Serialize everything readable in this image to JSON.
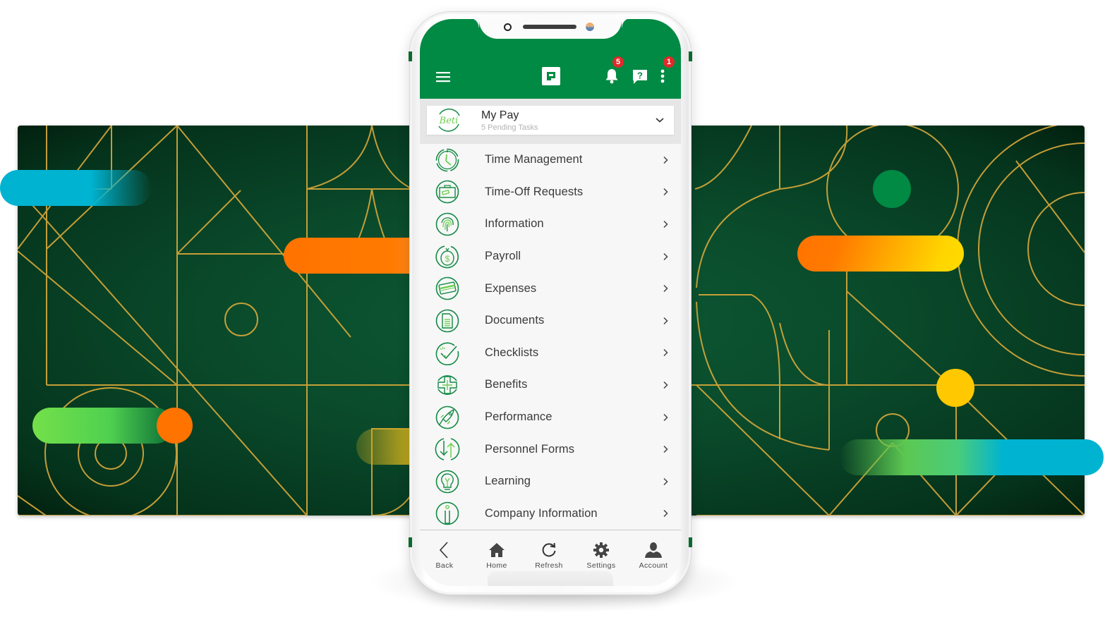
{
  "app": {
    "name": "Paycom",
    "brand_color": "#008a43",
    "badge_color": "#e02a2a"
  },
  "header": {
    "menu_icon": "hamburger-icon",
    "logo_icon": "paycom-logo-icon",
    "notifications": {
      "icon": "bell-icon",
      "count": "5"
    },
    "help": {
      "icon": "help-chat-icon",
      "glyph": "?"
    },
    "more": {
      "icon": "kebab-menu-icon",
      "count": "1"
    }
  },
  "context": {
    "logo": "Beti",
    "title": "My Pay",
    "subtitle": "5 Pending Tasks",
    "chevron": "chevron-down-icon"
  },
  "menu": {
    "items": [
      {
        "label": "Time Management",
        "icon": "clock-icon"
      },
      {
        "label": "Time-Off Requests",
        "icon": "suitcase-icon"
      },
      {
        "label": "Information",
        "icon": "fingerprint-icon"
      },
      {
        "label": "Payroll",
        "icon": "money-bag-icon"
      },
      {
        "label": "Expenses",
        "icon": "credit-card-icon"
      },
      {
        "label": "Documents",
        "icon": "document-icon"
      },
      {
        "label": "Checklists",
        "icon": "checkmark-icon"
      },
      {
        "label": "Benefits",
        "icon": "medical-cross-icon"
      },
      {
        "label": "Performance",
        "icon": "rocket-icon"
      },
      {
        "label": "Personnel Forms",
        "icon": "up-down-arrows-icon"
      },
      {
        "label": "Learning",
        "icon": "lightbulb-icon"
      },
      {
        "label": "Company Information",
        "icon": "info-icon"
      }
    ]
  },
  "bottom_nav": {
    "items": [
      {
        "label": "Back",
        "icon": "back-chevron-icon"
      },
      {
        "label": "Home",
        "icon": "home-icon"
      },
      {
        "label": "Refresh",
        "icon": "refresh-icon"
      },
      {
        "label": "Settings",
        "icon": "gear-icon"
      },
      {
        "label": "Account",
        "icon": "user-icon"
      }
    ]
  },
  "background": {
    "colors": {
      "base_green": "#0a4a2b",
      "line_gold": "#d9a93a",
      "cyan": "#00b3d1",
      "orange": "#ff7300",
      "yellow": "#ffd200",
      "light_green": "#74e04a",
      "accent_green": "#008a43",
      "dot_yellow": "#ffc800"
    }
  }
}
